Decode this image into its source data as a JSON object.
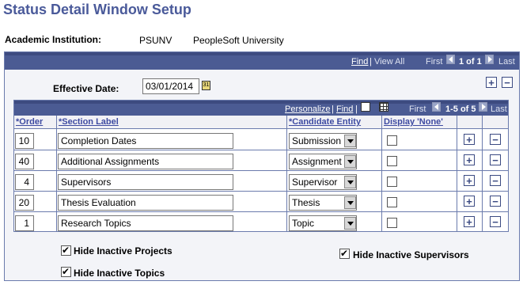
{
  "page": {
    "title": "Status Detail Window Setup"
  },
  "institution": {
    "label": "Academic Institution:",
    "code": "PSUNV",
    "name": "PeopleSoft University"
  },
  "outer_nav": {
    "find": "Find",
    "sep": "|",
    "view_all": "View All",
    "first": "First",
    "position": "1 of 1",
    "last": "Last"
  },
  "effective_date": {
    "label": "Effective Date:",
    "value": "03/01/2014"
  },
  "grid": {
    "nav": {
      "personalize": "Personalize",
      "sep1": "|",
      "find": "Find",
      "sep2": "|",
      "first": "First",
      "position": "1-5 of 5",
      "last": "Last"
    },
    "headers": {
      "order": "*Order",
      "section_label": "*Section Label",
      "candidate_entity": "*Candidate Entity",
      "display_none": "Display 'None'"
    },
    "rows": [
      {
        "order": "10",
        "label": "Completion Dates",
        "entity": "Submission",
        "display_none": false
      },
      {
        "order": "40",
        "label": "Additional Assignments",
        "entity": "Assignment",
        "display_none": false
      },
      {
        "order": "4",
        "label": "Supervisors",
        "entity": "Supervisor",
        "display_none": false
      },
      {
        "order": "20",
        "label": "Thesis Evaluation",
        "entity": "Thesis",
        "display_none": false
      },
      {
        "order": "1",
        "label": "Research Topics",
        "entity": "Topic",
        "display_none": false
      }
    ]
  },
  "options": {
    "hide_inactive_projects": {
      "label": "Hide Inactive Projects",
      "checked": true
    },
    "hide_inactive_topics": {
      "label": "Hide Inactive Topics",
      "checked": true
    },
    "hide_inactive_supervisors": {
      "label": "Hide Inactive Supervisors",
      "checked": true
    }
  },
  "icons": {
    "add": "+",
    "remove": "−"
  },
  "colors": {
    "title": "#4a5a9a",
    "bar": "#4b5b93",
    "link": "#3d4aa1"
  }
}
